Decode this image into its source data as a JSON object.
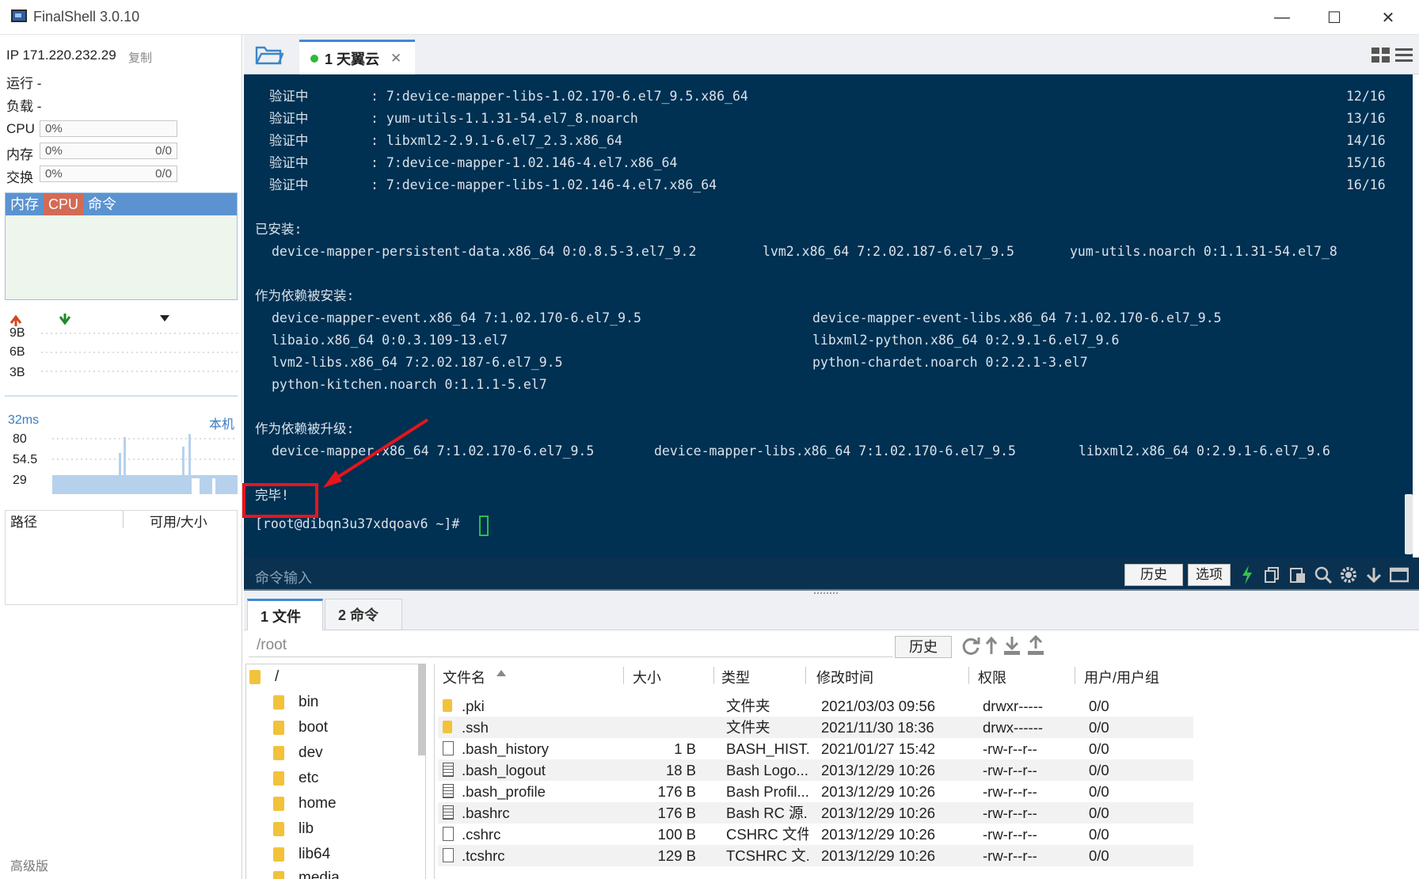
{
  "window": {
    "title": "FinalShell 3.0.10"
  },
  "left": {
    "ip_label": "IP 171.220.232.29",
    "copy_label": "复制",
    "run_label": "运行 -",
    "load_label": "负载 -",
    "cpu_label": "CPU",
    "cpu_value": "0%",
    "mem_label": "内存",
    "mem_value": "0%",
    "mem_ratio": "0/0",
    "swap_label": "交换",
    "swap_value": "0%",
    "swap_ratio": "0/0",
    "monitor_tabs": [
      "内存",
      "CPU",
      "命令"
    ],
    "net_ticks": [
      "9B",
      "6B",
      "3B"
    ],
    "ping_label": "32ms",
    "ping_host": "本机",
    "ping_ticks": [
      "80",
      "54.5",
      "29"
    ],
    "disk_headers": [
      "路径",
      "可用/大小"
    ],
    "edition": "高级版"
  },
  "session": {
    "tab_label": "1 天翼云",
    "status_color": "#2cba3a"
  },
  "terminal": {
    "lines": [
      {
        "a": "  验证中",
        "b": ": 7:device-mapper-libs-1.02.170-6.el7_9.5.x86_64",
        "c": "12/16"
      },
      {
        "a": "  验证中",
        "b": ": yum-utils-1.1.31-54.el7_8.noarch",
        "c": "13/16"
      },
      {
        "a": "  验证中",
        "b": ": libxml2-2.9.1-6.el7_2.3.x86_64",
        "c": "14/16"
      },
      {
        "a": "  验证中",
        "b": ": 7:device-mapper-1.02.146-4.el7.x86_64",
        "c": "15/16"
      },
      {
        "a": "  验证中",
        "b": ": 7:device-mapper-libs-1.02.146-4.el7.x86_64",
        "c": "16/16"
      }
    ],
    "installed_header": "已安装:",
    "installed": [
      "device-mapper-persistent-data.x86_64 0:0.8.5-3.el7_9.2",
      "lvm2.x86_64 7:2.02.187-6.el7_9.5",
      "yum-utils.noarch 0:1.1.31-54.el7_8"
    ],
    "dep_header": "作为依赖被安装:",
    "deps": [
      [
        "device-mapper-event.x86_64 7:1.02.170-6.el7_9.5",
        "device-mapper-event-libs.x86_64 7:1.02.170-6.el7_9.5"
      ],
      [
        "libaio.x86_64 0:0.3.109-13.el7",
        "libxml2-python.x86_64 0:2.9.1-6.el7_9.6"
      ],
      [
        "lvm2-libs.x86_64 7:2.02.187-6.el7_9.5",
        "python-chardet.noarch 0:2.2.1-3.el7"
      ],
      [
        "python-kitchen.noarch 0:1.1.1-5.el7",
        ""
      ]
    ],
    "upgrade_header": "作为依赖被升级:",
    "upgrades": [
      "device-mapper.x86_64 7:1.02.170-6.el7_9.5",
      "device-mapper-libs.x86_64 7:1.02.170-6.el7_9.5",
      "libxml2.x86_64 0:2.9.1-6.el7_9.6"
    ],
    "done": "完毕!",
    "prompt": "[root@dibqn3u37xdqoav6 ~]#"
  },
  "cmdbar": {
    "placeholder": "命令输入",
    "history": "历史",
    "options": "选项"
  },
  "filetabs": [
    "1 文件",
    "2 命令"
  ],
  "path": {
    "value": "/root",
    "history": "历史"
  },
  "tree": [
    "/",
    "bin",
    "boot",
    "dev",
    "etc",
    "home",
    "lib",
    "lib64",
    "media"
  ],
  "table": {
    "headers": [
      "文件名",
      "大小",
      "类型",
      "修改时间",
      "权限",
      "用户/用户组"
    ],
    "rows": [
      {
        "icon": "folder",
        "name": ".pki",
        "size": "",
        "type": "文件夹",
        "mtime": "2021/03/03 09:56",
        "perm": "drwxr-----",
        "owner": "0/0"
      },
      {
        "icon": "folder",
        "name": ".ssh",
        "size": "",
        "type": "文件夹",
        "mtime": "2021/11/30 18:36",
        "perm": "drwx------",
        "owner": "0/0"
      },
      {
        "icon": "file",
        "name": ".bash_history",
        "size": "1 B",
        "type": "BASH_HIST...",
        "mtime": "2021/01/27 15:42",
        "perm": "-rw-r--r--",
        "owner": "0/0"
      },
      {
        "icon": "doc",
        "name": ".bash_logout",
        "size": "18 B",
        "type": "Bash Logo...",
        "mtime": "2013/12/29 10:26",
        "perm": "-rw-r--r--",
        "owner": "0/0"
      },
      {
        "icon": "doc",
        "name": ".bash_profile",
        "size": "176 B",
        "type": "Bash Profil...",
        "mtime": "2013/12/29 10:26",
        "perm": "-rw-r--r--",
        "owner": "0/0"
      },
      {
        "icon": "doc",
        "name": ".bashrc",
        "size": "176 B",
        "type": "Bash RC 源...",
        "mtime": "2013/12/29 10:26",
        "perm": "-rw-r--r--",
        "owner": "0/0"
      },
      {
        "icon": "file",
        "name": ".cshrc",
        "size": "100 B",
        "type": "CSHRC 文件",
        "mtime": "2013/12/29 10:26",
        "perm": "-rw-r--r--",
        "owner": "0/0"
      },
      {
        "icon": "file",
        "name": ".tcshrc",
        "size": "129 B",
        "type": "TCSHRC 文...",
        "mtime": "2013/12/29 10:26",
        "perm": "-rw-r--r--",
        "owner": "0/0"
      }
    ]
  },
  "colors": {
    "terminal_bg": "#003052",
    "annotation": "#e8141c",
    "accent": "#3f87d9"
  }
}
